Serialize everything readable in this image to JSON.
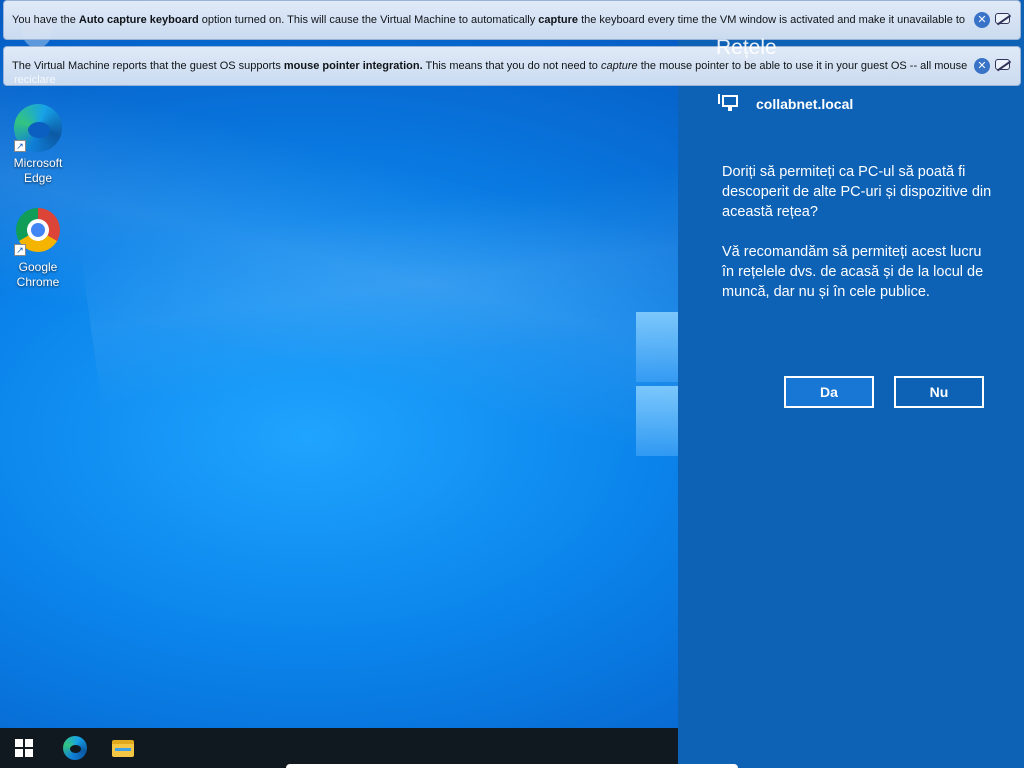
{
  "desktop": {
    "icons": [
      {
        "label": "Microsoft Edge",
        "icon": "edge-icon"
      },
      {
        "label": "Google Chrome",
        "icon": "chrome-icon"
      }
    ],
    "recycle_bin_label": "reciclare"
  },
  "taskbar": {
    "start": "windows-start-icon",
    "pinned": [
      "edge-icon",
      "file-explorer-icon"
    ]
  },
  "notifications": [
    {
      "parts": [
        {
          "t": "You have the ",
          "s": "n"
        },
        {
          "t": "Auto capture keyboard",
          "s": "b"
        },
        {
          "t": " option turned on. This will cause the Virtual Machine to automatically ",
          "s": "n"
        },
        {
          "t": "capture",
          "s": "b"
        },
        {
          "t": " the keyboard every time the VM window is activated and make it unavailable to",
          "s": "n"
        }
      ]
    },
    {
      "parts": [
        {
          "t": "The Virtual Machine reports that the guest OS supports ",
          "s": "n"
        },
        {
          "t": "mouse pointer integration.",
          "s": "b"
        },
        {
          "t": " This means that you do not need to ",
          "s": "n"
        },
        {
          "t": "capture",
          "s": "i"
        },
        {
          "t": " the mouse pointer to be able to use it in your guest OS -- all mouse",
          "s": "n"
        }
      ]
    }
  ],
  "flyout": {
    "title": "Rețele",
    "network_name": "collabnet.local",
    "paragraph1": "Doriți să permiteți ca PC-ul să poată fi descoperit de alte PC-uri și dispozitive din această rețea?",
    "paragraph2": "Vă recomandăm să permiteți acest lucru în rețelele dvs. de acasă și de la locul de muncă, dar nu și în cele publice.",
    "yes_label": "Da",
    "no_label": "Nu"
  },
  "colors": {
    "flyout_bg": "#0d62b6",
    "taskbar_bg": "#101820",
    "notification_bg": "#e9f0fa"
  }
}
